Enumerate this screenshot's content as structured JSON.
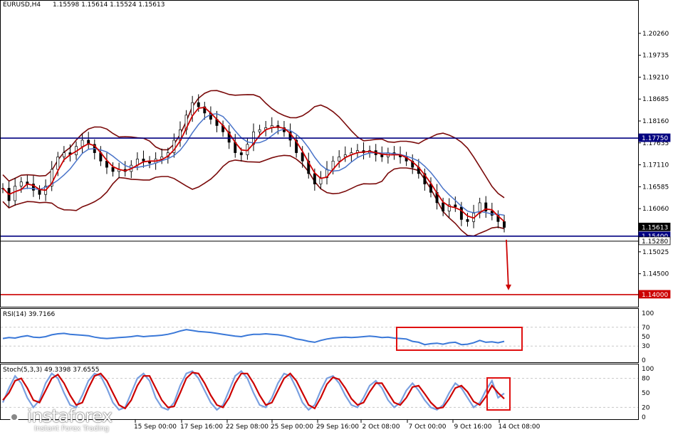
{
  "header": {
    "symbol": "EURUSD,H4",
    "ohlc": "1.15598 1.15614 1.15524 1.15613"
  },
  "colors": {
    "price_bars": "#000000",
    "fast_ma": "#cc0000",
    "slow_ma": "#4a74c9",
    "bollinger": "#7a0a0a",
    "support_line": "#000080",
    "target_line": "#cc0000",
    "resistance_line": "#000080",
    "rsi_line": "#3a78d8",
    "stoch_main": "#7aa0e0",
    "stoch_signal": "#cc0000",
    "highlight_box": "#e01010"
  },
  "chart_data": [
    {
      "type": "line",
      "name_ref": "price",
      "ylim": [
        1.1376,
        1.2082
      ],
      "y_ticks": [
        "1.20260",
        "1.19735",
        "1.19210",
        "1.18685",
        "1.18160",
        "1.17635",
        "1.17110",
        "1.16585",
        "1.16060",
        "1.15025",
        "1.14500"
      ],
      "y_tick_values": [
        1.2026,
        1.19735,
        1.1921,
        1.18685,
        1.1816,
        1.17635,
        1.1711,
        1.16585,
        1.1606,
        1.15025,
        1.145
      ],
      "x_ticks": [
        "15 Sep 00:00",
        "17 Sep 16:00",
        "22 Sep 08:00",
        "25 Sep 00:00",
        "29 Sep 16:00",
        "2 Oct 08:00",
        "7 Oct 00:00",
        "9 Oct 16:00",
        "14 Oct 08:00"
      ],
      "price_labels": [
        {
          "text": "1.17750",
          "value": 1.1775,
          "style": "resistance"
        },
        {
          "text": "1.15613",
          "value": 1.15613,
          "style": "current"
        },
        {
          "text": "1.15400",
          "value": 1.154,
          "style": "support"
        },
        {
          "text": "1.15280",
          "value": 1.1528,
          "style": "plain"
        },
        {
          "text": "1.14000",
          "value": 1.14,
          "style": "target"
        }
      ],
      "close": [
        1.1655,
        1.1625,
        1.166,
        1.167,
        1.1665,
        1.165,
        1.164,
        1.166,
        1.17,
        1.173,
        1.174,
        1.1735,
        1.1755,
        1.177,
        1.176,
        1.174,
        1.172,
        1.1705,
        1.1695,
        1.17,
        1.1695,
        1.171,
        1.1725,
        1.172,
        1.1715,
        1.1725,
        1.173,
        1.174,
        1.177,
        1.1795,
        1.183,
        1.186,
        1.185,
        1.1835,
        1.182,
        1.1805,
        1.179,
        1.1765,
        1.174,
        1.1735,
        1.176,
        1.179,
        1.1795,
        1.18,
        1.1805,
        1.18,
        1.179,
        1.177,
        1.174,
        1.172,
        1.169,
        1.1665,
        1.168,
        1.17,
        1.172,
        1.173,
        1.1735,
        1.174,
        1.1745,
        1.174,
        1.1745,
        1.1735,
        1.173,
        1.174,
        1.1735,
        1.173,
        1.172,
        1.1705,
        1.169,
        1.1665,
        1.1645,
        1.162,
        1.16,
        1.1615,
        1.161,
        1.158,
        1.1575,
        1.1595,
        1.162,
        1.16,
        1.159,
        1.1575,
        1.1561
      ]
    },
    {
      "type": "line",
      "title": "RSI(14) 39.7166",
      "ylim": [
        0,
        100
      ],
      "y_ticks": [
        "100",
        "70",
        "50",
        "30",
        "0"
      ],
      "y_tick_values": [
        100,
        70,
        50,
        30,
        0
      ],
      "values": [
        46,
        48,
        47,
        50,
        52,
        49,
        48,
        50,
        54,
        56,
        57,
        55,
        54,
        53,
        52,
        49,
        47,
        46,
        47,
        48,
        49,
        50,
        52,
        50,
        51,
        52,
        53,
        55,
        58,
        62,
        65,
        63,
        61,
        60,
        59,
        57,
        55,
        53,
        51,
        50,
        53,
        55,
        55,
        56,
        55,
        54,
        52,
        49,
        45,
        43,
        40,
        38,
        42,
        45,
        47,
        48,
        49,
        48,
        49,
        50,
        51,
        50,
        48,
        49,
        47,
        46,
        45,
        40,
        38,
        33,
        35,
        36,
        34,
        37,
        38,
        33,
        34,
        37,
        42,
        38,
        39,
        37,
        40
      ]
    },
    {
      "type": "line",
      "title": "Stoch(5,3,3) 49.3398 37.6555",
      "ylim": [
        0,
        100
      ],
      "y_ticks": [
        "100",
        "80",
        "50",
        "20",
        "0"
      ],
      "y_tick_values": [
        100,
        80,
        50,
        20,
        0
      ],
      "series": [
        {
          "name": "49.3398",
          "values": [
            30,
            60,
            85,
            70,
            40,
            20,
            35,
            70,
            90,
            80,
            50,
            25,
            20,
            45,
            75,
            90,
            85,
            60,
            30,
            15,
            20,
            50,
            80,
            90,
            75,
            40,
            20,
            15,
            30,
            65,
            90,
            95,
            80,
            55,
            30,
            15,
            25,
            55,
            85,
            95,
            80,
            50,
            25,
            20,
            40,
            70,
            90,
            85,
            60,
            30,
            15,
            25,
            55,
            80,
            85,
            70,
            45,
            25,
            20,
            40,
            65,
            75,
            60,
            35,
            20,
            30,
            55,
            70,
            55,
            35,
            20,
            15,
            25,
            50,
            70,
            60,
            40,
            20,
            30,
            55,
            75,
            40,
            49
          ]
        },
        {
          "name": "37.6555",
          "values": [
            35,
            50,
            75,
            80,
            60,
            35,
            30,
            55,
            80,
            88,
            70,
            45,
            25,
            30,
            60,
            85,
            90,
            75,
            50,
            25,
            18,
            35,
            65,
            85,
            85,
            60,
            35,
            20,
            22,
            50,
            80,
            92,
            90,
            70,
            45,
            25,
            20,
            40,
            70,
            90,
            90,
            70,
            45,
            25,
            30,
            55,
            80,
            90,
            75,
            50,
            25,
            18,
            40,
            68,
            82,
            78,
            60,
            38,
            25,
            30,
            52,
            70,
            70,
            50,
            30,
            25,
            40,
            62,
            65,
            48,
            30,
            18,
            20,
            38,
            60,
            65,
            52,
            32,
            25,
            42,
            65,
            50,
            38
          ]
        }
      ]
    }
  ],
  "watermark": {
    "brand": "instaforex",
    "tagline": "Instant Forex Trading"
  }
}
